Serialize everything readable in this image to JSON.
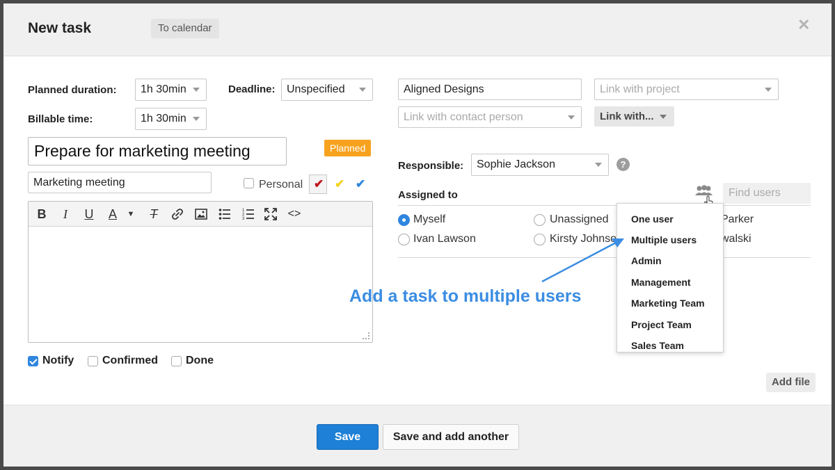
{
  "header": {
    "title": "New task",
    "to_calendar": "To calendar"
  },
  "form": {
    "planned_duration_label": "Planned duration:",
    "planned_duration_value": "1h 30min",
    "deadline_label": "Deadline:",
    "deadline_value": "Unspecified",
    "billable_time_label": "Billable time:",
    "billable_time_value": "1h 30min",
    "task_title": "Prepare for marketing meeting",
    "status_badge": "Planned",
    "subtitle": "Marketing meeting",
    "personal_label": "Personal",
    "colors": {
      "red": "#c0121c",
      "yellow": "#f3d21e",
      "blue": "#2f86de",
      "accent": "#1e80d6",
      "badge": "#f7a21e"
    }
  },
  "editor": {
    "toolbar": [
      "bold-icon",
      "italic-icon",
      "underline-icon",
      "text-color-icon",
      "clear-format-icon",
      "link-icon",
      "image-icon",
      "bullet-list-icon",
      "numbered-list-icon",
      "fullscreen-icon",
      "code-icon"
    ]
  },
  "options": {
    "notify": "Notify",
    "confirmed": "Confirmed",
    "done": "Done"
  },
  "right": {
    "company_value": "Aligned Designs",
    "project_placeholder": "Link with project",
    "contact_placeholder": "Link with contact person",
    "link_with": "Link with...",
    "responsible_label": "Responsible:",
    "responsible_value": "Sophie Jackson",
    "assigned_label": "Assigned to",
    "find_users_placeholder": "Find users",
    "assignees": [
      "Myself",
      "Unassigned",
      "Parker",
      "Ivan Lawson",
      "Kirsty Johnson",
      "walski"
    ]
  },
  "dropdown": {
    "items": [
      "One user",
      "Multiple users",
      "Admin",
      "Management",
      "Marketing Team",
      "Project Team",
      "Sales Team"
    ]
  },
  "annotation": "Add a task to multiple users",
  "add_file": "Add file",
  "footer": {
    "save": "Save",
    "save_and_add": "Save and add another"
  }
}
